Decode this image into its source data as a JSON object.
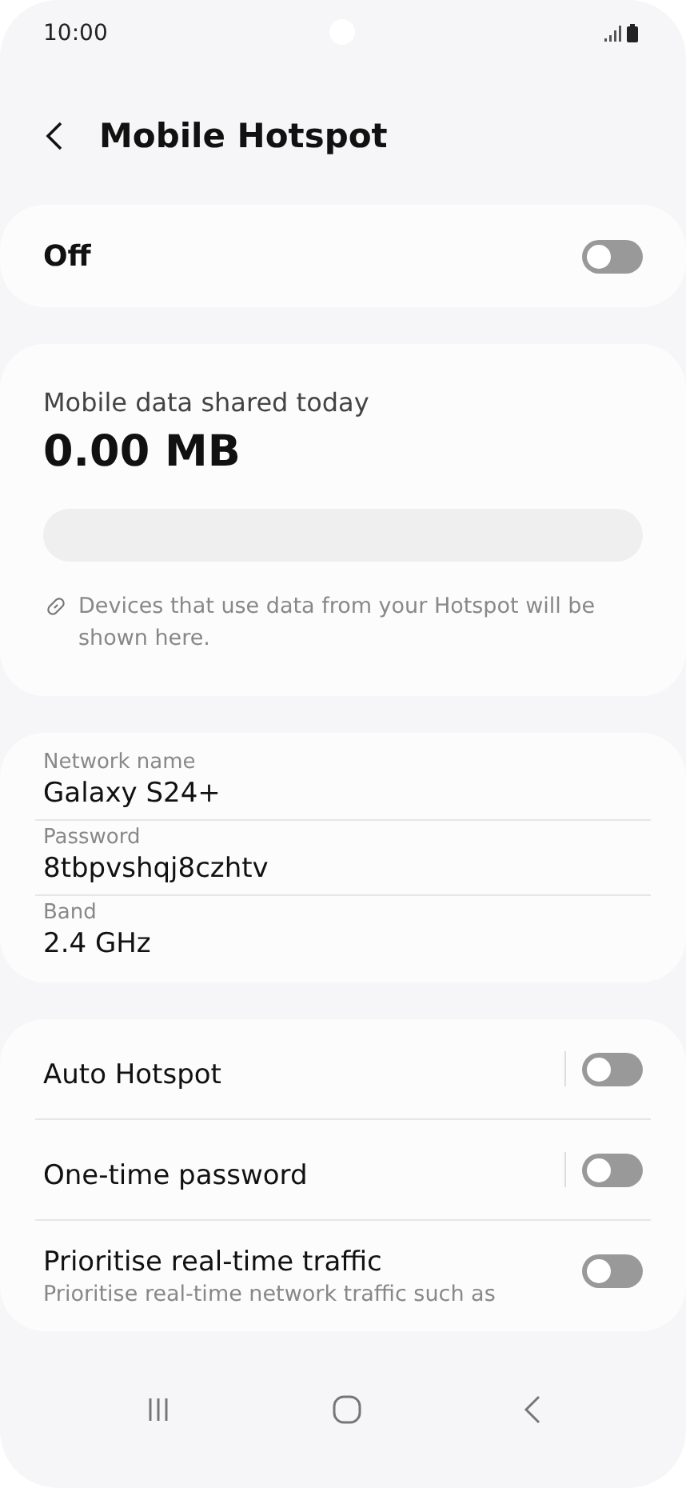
{
  "status_bar": {
    "time": "10:00"
  },
  "header": {
    "title": "Mobile Hotspot"
  },
  "master_switch": {
    "label": "Off",
    "on": false
  },
  "usage": {
    "label": "Mobile data shared today",
    "amount": "0.00 MB",
    "level": 0,
    "note": "Devices that use data from your Hotspot will be shown here."
  },
  "network": [
    {
      "label": "Network name",
      "value": "Galaxy S24+"
    },
    {
      "label": "Password",
      "value": "8tbpvshqj8czhtv"
    },
    {
      "label": "Band",
      "value": "2.4 GHz"
    }
  ],
  "options": [
    {
      "title": "Auto Hotspot",
      "on": false,
      "divider": true
    },
    {
      "title": "One-time password",
      "on": false,
      "divider": true
    },
    {
      "title": "Prioritise real-time traffic",
      "description": "Prioritise real-time network traffic such as",
      "on": false,
      "divider": false
    }
  ]
}
